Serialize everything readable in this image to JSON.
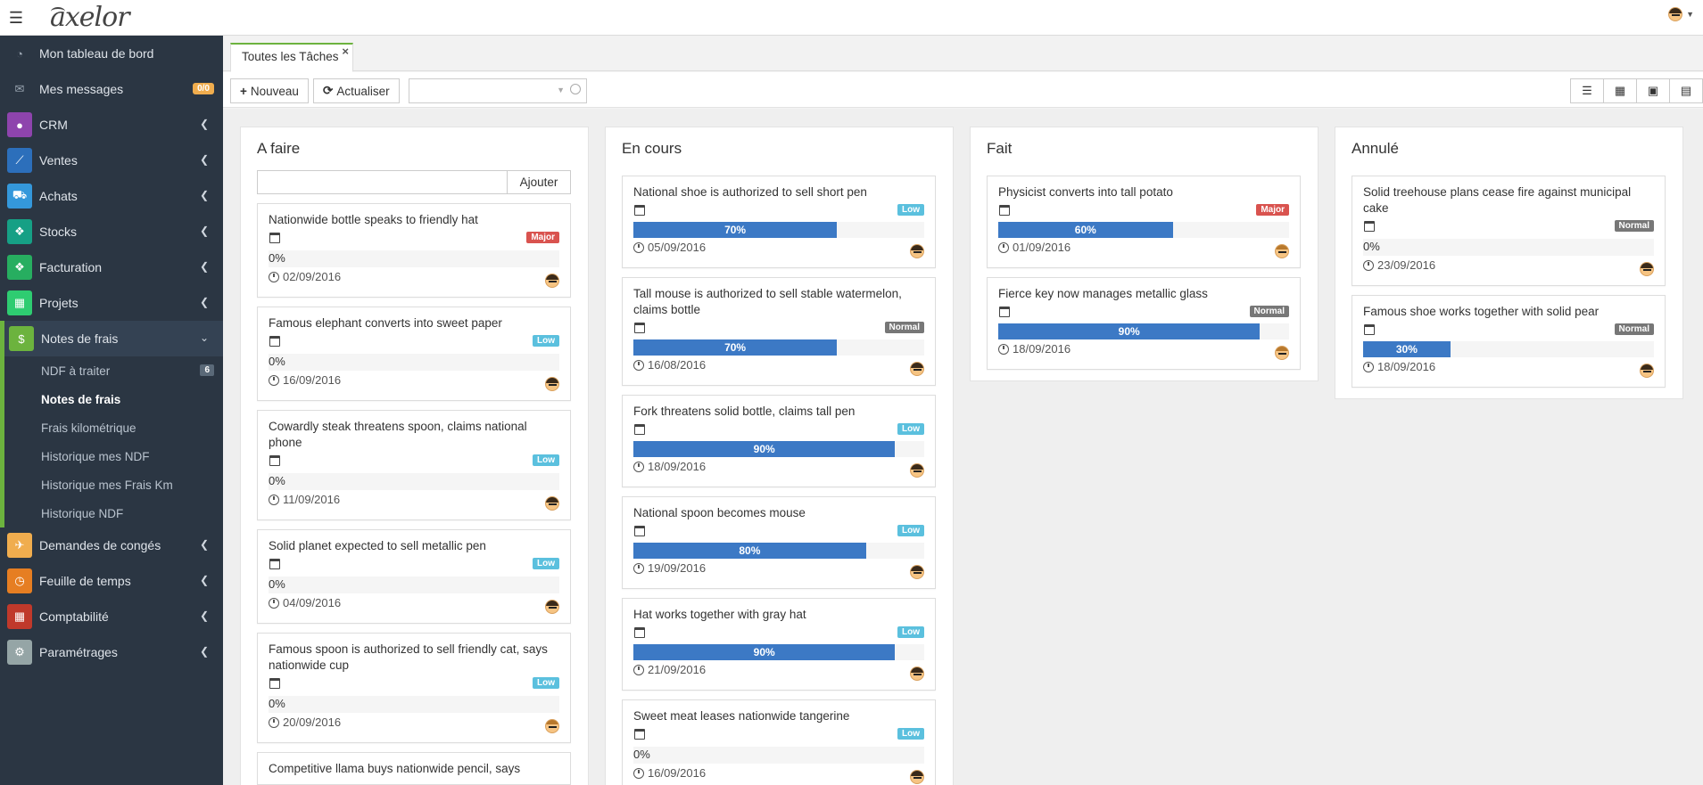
{
  "app": {
    "logo": "axelor"
  },
  "colors": {
    "sidebar_bg": "#2b3643",
    "accent_green": "#6cb33e",
    "progress_blue": "#3c79c5",
    "low": "#5bc0de",
    "normal": "#777777",
    "major": "#d9534f",
    "badge_warn": "#f0ad4e"
  },
  "sidebar": {
    "items": [
      {
        "label": "Mon tableau de bord",
        "icon": "dashboard-icon"
      },
      {
        "label": "Mes messages",
        "icon": "envelope-icon",
        "badge": "0/0"
      },
      {
        "label": "CRM",
        "icon": "user-icon",
        "color": "#8e44ad"
      },
      {
        "label": "Ventes",
        "icon": "line-chart-icon",
        "color": "#2c6fbb"
      },
      {
        "label": "Achats",
        "icon": "cart-icon",
        "color": "#3498db"
      },
      {
        "label": "Stocks",
        "icon": "cubes-icon",
        "color": "#16a085"
      },
      {
        "label": "Facturation",
        "icon": "cubes-icon",
        "color": "#27ae60"
      },
      {
        "label": "Projets",
        "icon": "calculator-icon",
        "color": "#2ecc71"
      },
      {
        "label": "Notes de frais",
        "icon": "dollar-icon",
        "color": "#6cb33e"
      },
      {
        "label": "Demandes de congés",
        "icon": "plane-icon",
        "color": "#f0ad4e"
      },
      {
        "label": "Feuille de temps",
        "icon": "clock-icon",
        "color": "#e67e22"
      },
      {
        "label": "Comptabilité",
        "icon": "calculator-icon",
        "color": "#c0392b"
      },
      {
        "label": "Paramétrages",
        "icon": "gear-icon",
        "color": "#95a5a6"
      }
    ],
    "submenu": [
      {
        "label": "NDF à traiter",
        "count": "6"
      },
      {
        "label": "Notes de frais"
      },
      {
        "label": "Frais kilométrique"
      },
      {
        "label": "Historique mes NDF"
      },
      {
        "label": "Historique mes Frais Km"
      },
      {
        "label": "Historique NDF"
      }
    ]
  },
  "tab": {
    "label": "Toutes les Tâches",
    "close": "×"
  },
  "toolbar": {
    "new_label": "Nouveau",
    "new_icon": "+",
    "refresh_label": "Actualiser",
    "refresh_icon": "⟳",
    "search_value": "",
    "views": [
      "list-view-icon",
      "grid-view-icon",
      "calendar-view-icon",
      "form-view-icon"
    ]
  },
  "board": {
    "add_button": "Ajouter",
    "add_input_value": "",
    "columns": [
      {
        "title": "A faire",
        "cards": [
          {
            "title": "Nationwide bottle speaks to friendly hat",
            "priority": "Major",
            "progress": 0,
            "progress_label": "0%",
            "date": "02/09/2016",
            "avatar": "boy"
          },
          {
            "title": "Famous elephant converts into sweet paper",
            "priority": "Low",
            "progress": 0,
            "progress_label": "0%",
            "date": "16/09/2016",
            "avatar": "boy"
          },
          {
            "title": "Cowardly steak threatens spoon, claims national phone",
            "priority": "Low",
            "progress": 0,
            "progress_label": "0%",
            "date": "11/09/2016",
            "avatar": "boy"
          },
          {
            "title": "Solid planet expected to sell metallic pen",
            "priority": "Low",
            "progress": 0,
            "progress_label": "0%",
            "date": "04/09/2016",
            "avatar": "boy"
          },
          {
            "title": "Famous spoon is authorized to sell friendly cat, says nationwide cup",
            "priority": "Low",
            "progress": 0,
            "progress_label": "0%",
            "date": "20/09/2016",
            "avatar": "girl"
          },
          {
            "title": "Competitive llama buys nationwide pencil, says",
            "priority": "",
            "progress": 0,
            "progress_label": "",
            "date": "",
            "avatar": ""
          }
        ]
      },
      {
        "title": "En cours",
        "cards": [
          {
            "title": "National shoe is authorized to sell short pen",
            "priority": "Low",
            "progress": 70,
            "progress_label": "70%",
            "date": "05/09/2016",
            "avatar": "boy"
          },
          {
            "title": "Tall mouse is authorized to sell stable watermelon, claims bottle",
            "priority": "Normal",
            "progress": 70,
            "progress_label": "70%",
            "date": "16/08/2016",
            "avatar": "boy"
          },
          {
            "title": "Fork threatens solid bottle, claims tall pen",
            "priority": "Low",
            "progress": 90,
            "progress_label": "90%",
            "date": "18/09/2016",
            "avatar": "boy"
          },
          {
            "title": "National spoon becomes mouse",
            "priority": "Low",
            "progress": 80,
            "progress_label": "80%",
            "date": "19/09/2016",
            "avatar": "boy"
          },
          {
            "title": "Hat works together with gray hat",
            "priority": "Low",
            "progress": 90,
            "progress_label": "90%",
            "date": "21/09/2016",
            "avatar": "boy"
          },
          {
            "title": "Sweet meat leases nationwide tangerine",
            "priority": "Low",
            "progress": 0,
            "progress_label": "0%",
            "date": "16/09/2016",
            "avatar": "boy"
          }
        ]
      },
      {
        "title": "Fait",
        "cards": [
          {
            "title": "Physicist converts into tall potato",
            "priority": "Major",
            "progress": 60,
            "progress_label": "60%",
            "date": "01/09/2016",
            "avatar": "girl"
          },
          {
            "title": "Fierce key now manages metallic glass",
            "priority": "Normal",
            "progress": 90,
            "progress_label": "90%",
            "date": "18/09/2016",
            "avatar": "girl"
          }
        ]
      },
      {
        "title": "Annulé",
        "cards": [
          {
            "title": "Solid treehouse plans cease fire against municipal cake",
            "priority": "Normal",
            "progress": 0,
            "progress_label": "0%",
            "date": "23/09/2016",
            "avatar": "boy"
          },
          {
            "title": "Famous shoe works together with solid pear",
            "priority": "Normal",
            "progress": 30,
            "progress_label": "30%",
            "date": "18/09/2016",
            "avatar": "boy"
          }
        ]
      }
    ]
  }
}
